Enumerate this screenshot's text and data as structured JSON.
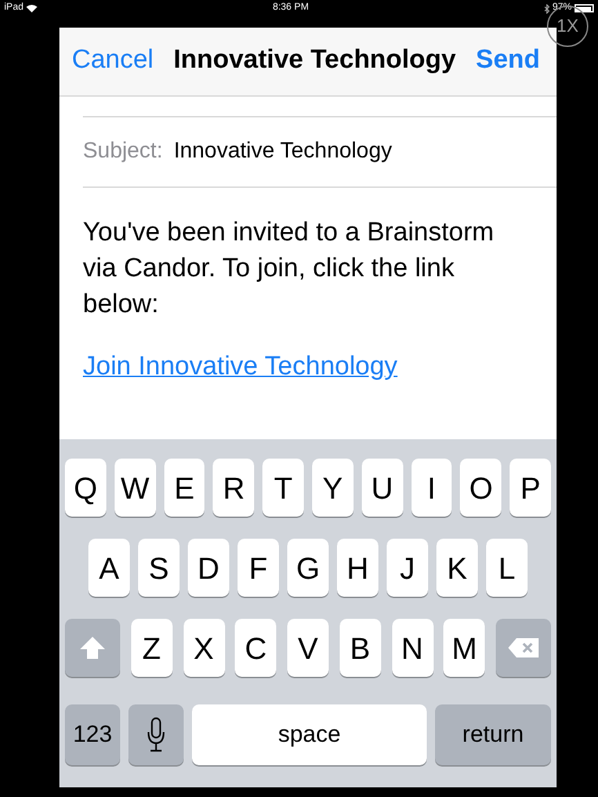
{
  "status_bar": {
    "device": "iPad",
    "time": "8:36 PM",
    "battery": "97%"
  },
  "zoom_badge": "1X",
  "nav": {
    "cancel": "Cancel",
    "title": "Innovative Technology",
    "send": "Send"
  },
  "subject": {
    "label": "Subject:",
    "value": "Innovative Technology"
  },
  "message": {
    "text": "You've been invited to a Brainstorm via Candor. To join, click the link below:",
    "link": "Join Innovative Technology"
  },
  "keyboard": {
    "rows": [
      {
        "keys": [
          {
            "kind": "letter",
            "label": "Q"
          },
          {
            "kind": "letter",
            "label": "W"
          },
          {
            "kind": "letter",
            "label": "E"
          },
          {
            "kind": "letter",
            "label": "R"
          },
          {
            "kind": "letter",
            "label": "T"
          },
          {
            "kind": "letter",
            "label": "Y"
          },
          {
            "kind": "letter",
            "label": "U"
          },
          {
            "kind": "letter",
            "label": "I"
          },
          {
            "kind": "letter",
            "label": "O"
          },
          {
            "kind": "letter",
            "label": "P"
          }
        ]
      },
      {
        "keys": [
          {
            "kind": "letter",
            "label": "A"
          },
          {
            "kind": "letter",
            "label": "S"
          },
          {
            "kind": "letter",
            "label": "D"
          },
          {
            "kind": "letter",
            "label": "F"
          },
          {
            "kind": "letter",
            "label": "G"
          },
          {
            "kind": "letter",
            "label": "H"
          },
          {
            "kind": "letter",
            "label": "J"
          },
          {
            "kind": "letter",
            "label": "K"
          },
          {
            "kind": "letter",
            "label": "L"
          }
        ]
      },
      {
        "keys": [
          {
            "kind": "shift"
          },
          {
            "kind": "letter",
            "label": "Z"
          },
          {
            "kind": "letter",
            "label": "X"
          },
          {
            "kind": "letter",
            "label": "C"
          },
          {
            "kind": "letter",
            "label": "V"
          },
          {
            "kind": "letter",
            "label": "B"
          },
          {
            "kind": "letter",
            "label": "N"
          },
          {
            "kind": "letter",
            "label": "M"
          },
          {
            "kind": "delete"
          }
        ]
      },
      {
        "keys": [
          {
            "kind": "numbers",
            "label": "123"
          },
          {
            "kind": "mic"
          },
          {
            "kind": "space",
            "label": "space"
          },
          {
            "kind": "return",
            "label": "return"
          }
        ]
      }
    ]
  }
}
